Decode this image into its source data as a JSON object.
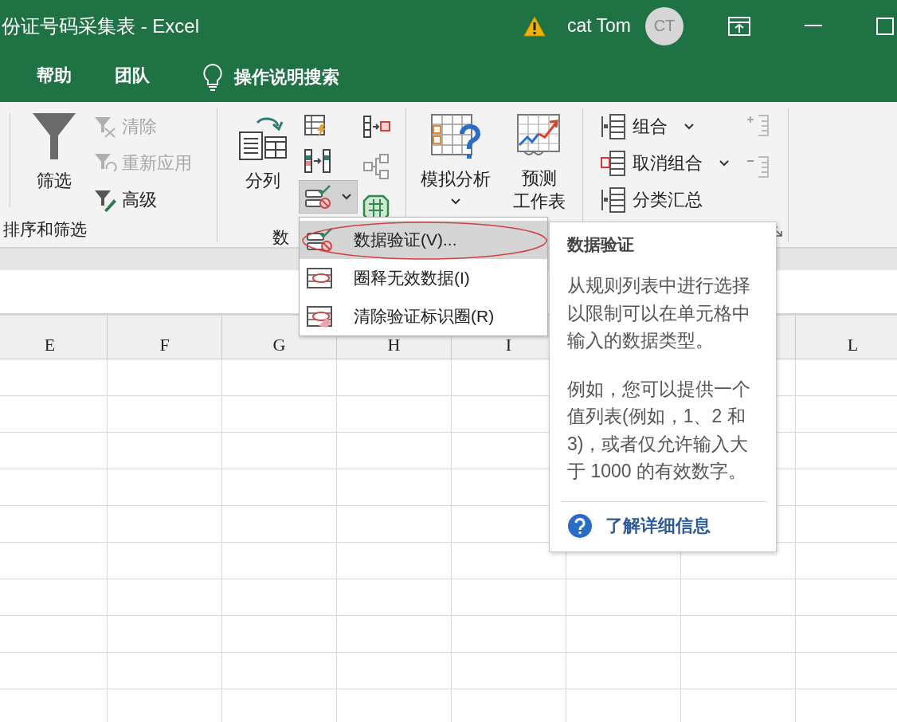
{
  "window": {
    "title": "份证号码采集表 - Excel",
    "user": "cat Tom",
    "avatar_initials": "CT"
  },
  "tabs": [
    {
      "label": "帮助",
      "selected": false
    },
    {
      "label": "团队",
      "selected": false
    }
  ],
  "search": {
    "label": "操作说明搜索"
  },
  "sort_filter": {
    "label": "排序和筛选",
    "filter": "筛选",
    "commands": [
      {
        "label": "清除",
        "disabled": true
      },
      {
        "label": "重新应用",
        "disabled": true
      },
      {
        "label": "高级",
        "disabled": false
      }
    ]
  },
  "data_tools": {
    "label": "数",
    "text_to_columns": "分列",
    "validation_pressed": true
  },
  "forecast": {
    "what_if": "模拟分析",
    "forecast_sheet": [
      "预测",
      "工作表"
    ]
  },
  "outline": {
    "commands": [
      {
        "label": "组合",
        "has_menu": true
      },
      {
        "label": "取消组合",
        "has_menu": true
      },
      {
        "label": "分类汇总",
        "has_menu": false
      }
    ]
  },
  "sheet": {
    "column_headers": [
      "E",
      "F",
      "G",
      "H",
      "I"
    ],
    "column_headers_right": [
      "L"
    ]
  },
  "menu": {
    "items": [
      {
        "label": "数据验证(V)...",
        "selected": true
      },
      {
        "label": "圈释无效数据(I)",
        "selected": false
      },
      {
        "label": "清除验证标识圈(R)",
        "selected": false
      }
    ]
  },
  "tooltip": {
    "title": "数据验证",
    "paragraphs": [
      "从规则列表中进行选择以限制可以在单元格中输入的数据类型。",
      "例如，您可以提供一个值列表(例如，1、2 和 3)，或者仅允许输入大于 1000 的有效数字。"
    ],
    "link": "了解详细信息"
  }
}
